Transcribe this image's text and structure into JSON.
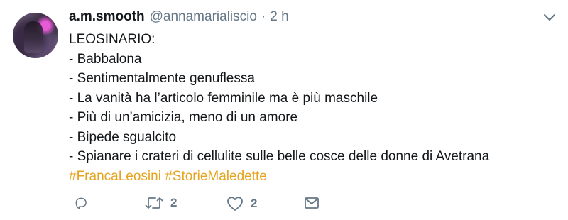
{
  "tweet": {
    "display_name": "a.m.smooth",
    "handle": "@annamarialiscio",
    "separator": "·",
    "time": "2 h",
    "lines": [
      "LEOSINARIO:",
      "- Babbalona",
      "- Sentimentalmente genuflessa",
      "- La vanità ha l’articolo femminile ma è più maschile",
      "- Più di un’amicizia, meno di un amore",
      "- Bipede sgualcito",
      "- Spianare i crateri di cellulite sulle belle cosce delle donne di Avetrana"
    ],
    "hashtags": [
      "#FrancaLeosini",
      "#StorieMaledette"
    ]
  },
  "actions": {
    "retweet_count": "2",
    "like_count": "2"
  },
  "icons": {
    "menu": "chevron-down-icon",
    "reply": "reply-icon",
    "retweet": "retweet-icon",
    "like": "heart-icon",
    "message": "envelope-icon"
  },
  "colors": {
    "text": "#14171a",
    "muted": "#657786",
    "hashtag": "#e5a31e"
  }
}
